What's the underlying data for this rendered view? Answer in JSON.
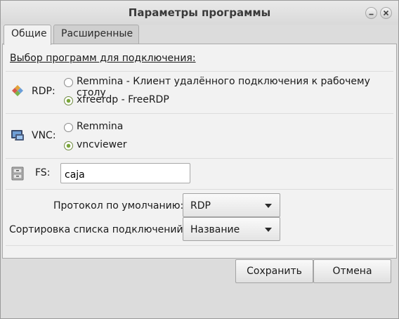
{
  "window": {
    "title": "Параметры программы",
    "controls": {
      "minimize_icon": "minimize-icon",
      "close_icon": "close-icon"
    }
  },
  "tabs": [
    {
      "label": "Общие",
      "active": true
    },
    {
      "label": "Расширенные",
      "active": false
    }
  ],
  "general": {
    "section_title": "Выбор программ для подключения:",
    "rdp": {
      "label": "RDP:",
      "icon": "rdp-icon",
      "options": [
        {
          "label": "Remmina - Клиент удалённого подключения к рабочему столу",
          "checked": false
        },
        {
          "label": "xfreerdp - FreeRDP",
          "checked": true
        }
      ]
    },
    "vnc": {
      "label": "VNC:",
      "icon": "vnc-monitor-icon",
      "options": [
        {
          "label": "Remmina",
          "checked": false
        },
        {
          "label": "vncviewer",
          "checked": true
        }
      ]
    },
    "fs": {
      "label": "FS:",
      "icon": "file-cabinet-icon",
      "value": "caja"
    },
    "default_protocol": {
      "label": "Протокол по умолчанию:",
      "value": "RDP"
    },
    "sort_order": {
      "label": "Сортировка списка подключений:",
      "value": "Название"
    }
  },
  "buttons": {
    "save": "Сохранить",
    "cancel": "Отмена"
  },
  "colors": {
    "window_bg": "#dcdcdc",
    "panel_bg": "#f2f2f2",
    "radio_accent": "#7aa63a"
  }
}
